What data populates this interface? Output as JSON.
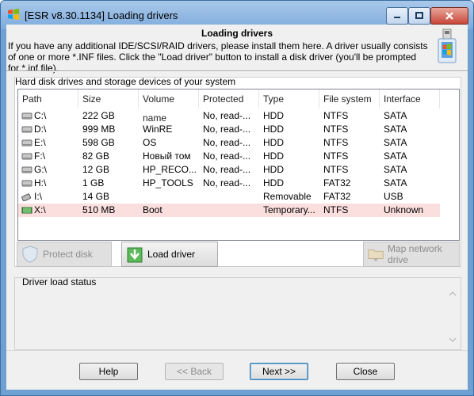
{
  "window": {
    "title": "[ESR v8.30.1134]  Loading drivers"
  },
  "header": {
    "title": "Loading drivers",
    "description": "If you have any additional IDE/SCSI/RAID drivers, please install them here. A driver usually consists of one or more *.INF files. Click the \"Load driver\" button to install a disk driver (you'll be prompted for *.inf file)."
  },
  "drives_group": {
    "label": "Hard disk drives and storage devices of your system",
    "columns": [
      "Path",
      "Size",
      "Volume name",
      "Protected",
      "Type",
      "File system",
      "Interface"
    ],
    "rows": [
      {
        "path": "C:\\",
        "size": "222 GB",
        "volume": "",
        "protected": "No, read-...",
        "type": "HDD",
        "fs": "NTFS",
        "iface": "SATA",
        "icon": "hdd-icon",
        "selected": false
      },
      {
        "path": "D:\\",
        "size": "999 MB",
        "volume": "WinRE",
        "protected": "No, read-...",
        "type": "HDD",
        "fs": "NTFS",
        "iface": "SATA",
        "icon": "hdd-icon",
        "selected": false
      },
      {
        "path": "E:\\",
        "size": "598 GB",
        "volume": "OS",
        "protected": "No, read-...",
        "type": "HDD",
        "fs": "NTFS",
        "iface": "SATA",
        "icon": "hdd-icon",
        "selected": false
      },
      {
        "path": "F:\\",
        "size": "82 GB",
        "volume": "Новый том",
        "protected": "No, read-...",
        "type": "HDD",
        "fs": "NTFS",
        "iface": "SATA",
        "icon": "hdd-icon",
        "selected": false
      },
      {
        "path": "G:\\",
        "size": "12 GB",
        "volume": "HP_RECO...",
        "protected": "No, read-...",
        "type": "HDD",
        "fs": "NTFS",
        "iface": "SATA",
        "icon": "hdd-icon",
        "selected": false
      },
      {
        "path": "H:\\",
        "size": "1 GB",
        "volume": "HP_TOOLS",
        "protected": "No, read-...",
        "type": "HDD",
        "fs": "FAT32",
        "iface": "SATA",
        "icon": "hdd-icon",
        "selected": false
      },
      {
        "path": "I:\\",
        "size": "14 GB",
        "volume": "",
        "protected": "",
        "type": "Removable",
        "fs": "FAT32",
        "iface": "USB",
        "icon": "usb-drive-icon",
        "selected": false
      },
      {
        "path": "X:\\",
        "size": "510 MB",
        "volume": "Boot",
        "protected": "",
        "type": "Temporary...",
        "fs": "NTFS",
        "iface": "Unknown",
        "icon": "ram-disk-icon",
        "selected": true
      }
    ],
    "buttons": {
      "protect_disk": "Protect disk",
      "load_driver": "Load driver",
      "map_network_drive": "Map network drive"
    }
  },
  "status_group": {
    "label": "Driver load status",
    "text": ""
  },
  "nav": {
    "help": "Help",
    "back": "<< Back",
    "next": "Next >>",
    "close": "Close"
  },
  "colors": {
    "selected_row": "#fbdede",
    "title_bar": "#7eabdc",
    "dialog_bg": "#f0f0f0"
  }
}
